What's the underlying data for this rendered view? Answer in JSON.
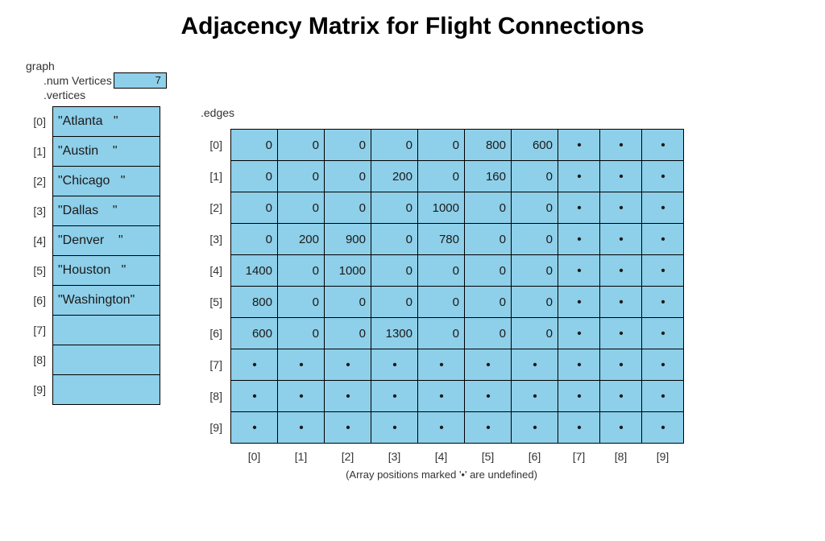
{
  "title": "Adjacency Matrix for Flight Connections",
  "labels": {
    "graph": "graph",
    "numVertices": ".num Vertices",
    "vertices": ".vertices",
    "edges": ".edges"
  },
  "numVertices": 7,
  "vertices_display": [
    "\"Atlanta   \"",
    "\"Austin    \"",
    "\"Chicago   \"",
    "\"Dallas    \"",
    "\"Denver    \"",
    "\"Houston   \"",
    "\"Washington\"",
    "",
    "",
    ""
  ],
  "row_indices": [
    "[0]",
    "[1]",
    "[2]",
    "[3]",
    "[4]",
    "[5]",
    "[6]",
    "[7]",
    "[8]",
    "[9]"
  ],
  "col_indices": [
    "[0]",
    "[1]",
    "[2]",
    "[3]",
    "[4]",
    "[5]",
    "[6]",
    "[7]",
    "[8]",
    "[9]"
  ],
  "matrix": [
    [
      0,
      0,
      0,
      0,
      0,
      800,
      600,
      null,
      null,
      null
    ],
    [
      0,
      0,
      0,
      200,
      0,
      160,
      0,
      null,
      null,
      null
    ],
    [
      0,
      0,
      0,
      0,
      1000,
      0,
      0,
      null,
      null,
      null
    ],
    [
      0,
      200,
      900,
      0,
      780,
      0,
      0,
      null,
      null,
      null
    ],
    [
      1400,
      0,
      1000,
      0,
      0,
      0,
      0,
      null,
      null,
      null
    ],
    [
      800,
      0,
      0,
      0,
      0,
      0,
      0,
      null,
      null,
      null
    ],
    [
      600,
      0,
      0,
      1300,
      0,
      0,
      0,
      null,
      null,
      null
    ],
    [
      null,
      null,
      null,
      null,
      null,
      null,
      null,
      null,
      null,
      null
    ],
    [
      null,
      null,
      null,
      null,
      null,
      null,
      null,
      null,
      null,
      null
    ],
    [
      null,
      null,
      null,
      null,
      null,
      null,
      null,
      null,
      null,
      null
    ]
  ],
  "undefined_glyph": "•",
  "footnote": "(Array positions marked '•' are undefined)",
  "colors": {
    "cell_bg": "#8ecfe9",
    "border": "#000000"
  }
}
